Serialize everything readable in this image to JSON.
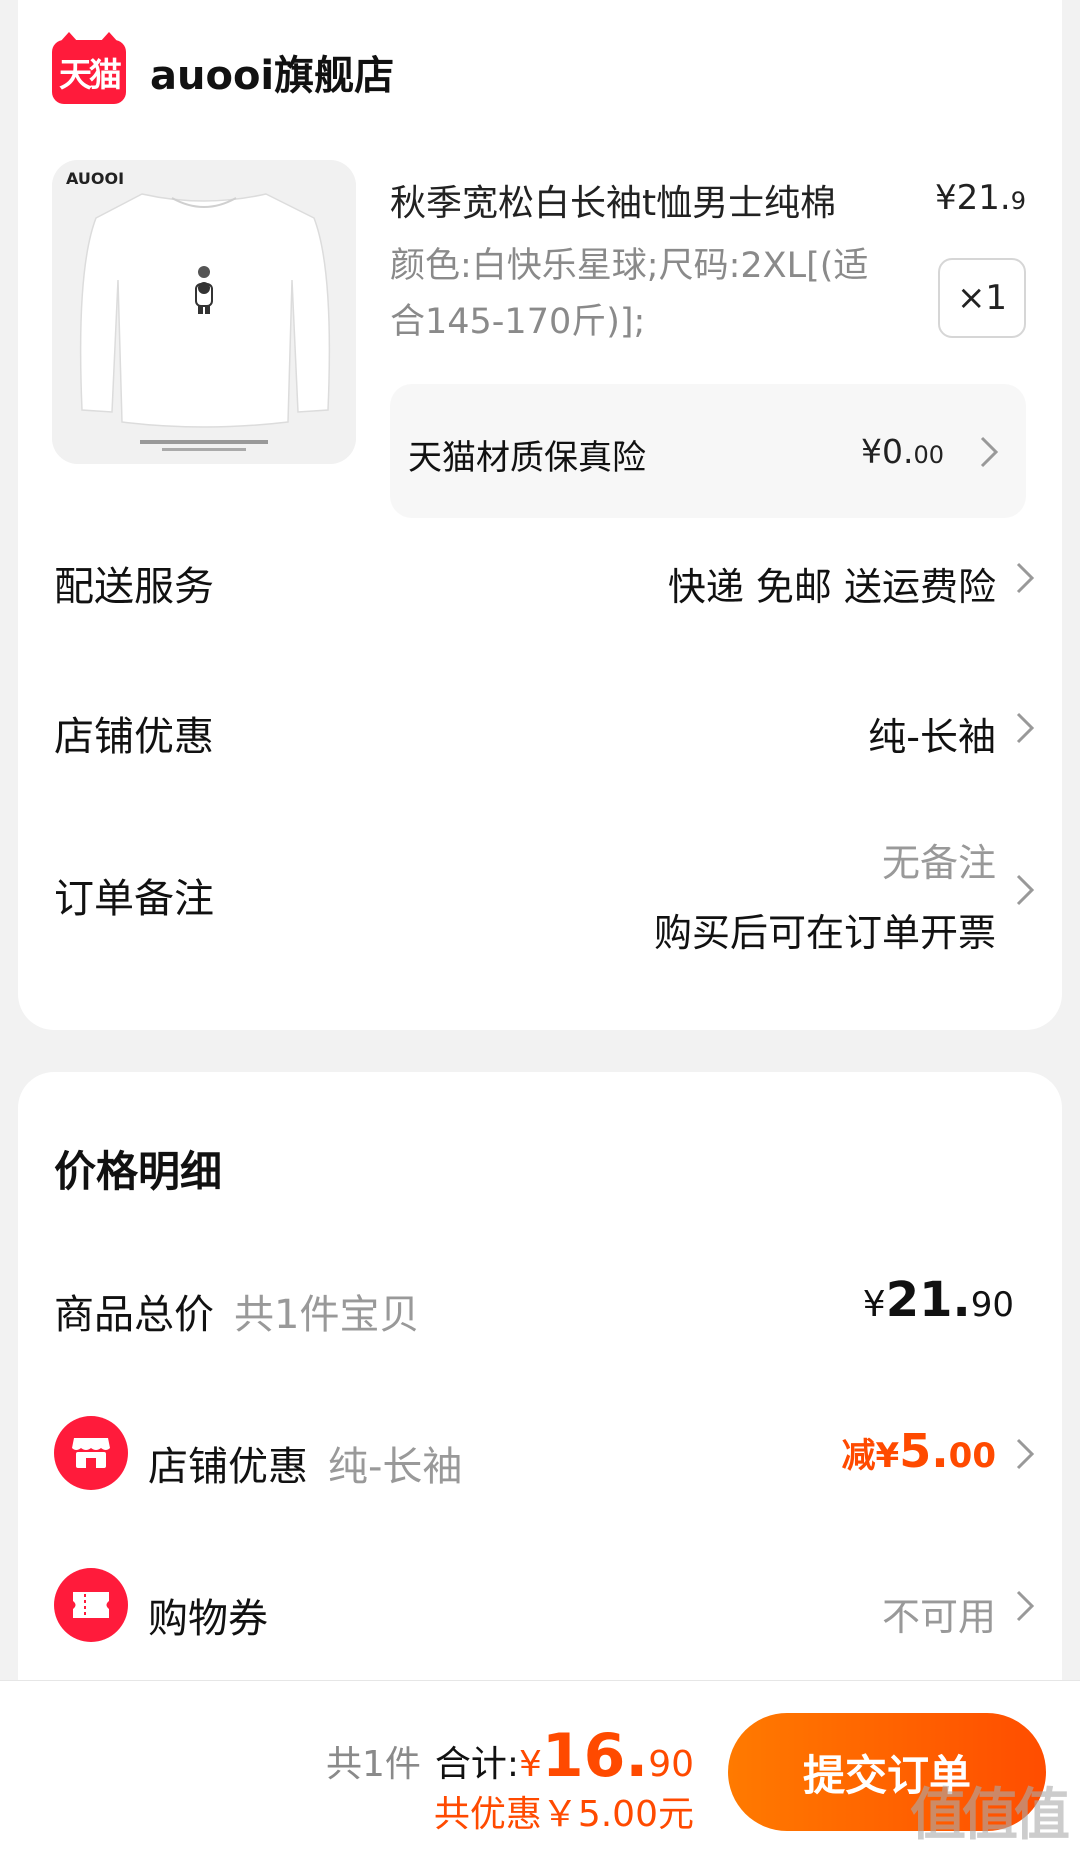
{
  "store": {
    "logo_text": "天猫",
    "name": "auooi旗舰店"
  },
  "product": {
    "brand_mark": "AUOOI",
    "title": "秋季宽松白长袖t恤男士纯棉",
    "price_currency": "¥",
    "price_int": "21.",
    "price_dec": "9",
    "spec_line1": "颜色:白快乐星球;尺码:2XL[(适",
    "spec_line2": "合145-170斤)];",
    "quantity": "×1",
    "insurance_label": "天猫材质保真险",
    "insurance_currency": "¥",
    "insurance_int": "0.",
    "insurance_dec": "00"
  },
  "rows": {
    "delivery_label": "配送服务",
    "delivery_value": "快递 免邮 送运费险",
    "coupon_label": "店铺优惠",
    "coupon_value": "纯-长袖",
    "note_label": "订单备注",
    "note_value": "无备注",
    "note_invoice": "购买后可在订单开票"
  },
  "price_detail": {
    "title": "价格明细",
    "goods_label": "商品总价",
    "goods_count": "共1件宝贝",
    "goods_currency": "¥",
    "goods_int": "21.",
    "goods_dec": "90",
    "shop_discount_label": "店铺优惠",
    "shop_discount_sub": "纯-长袖",
    "shop_discount_prefix": "减",
    "shop_discount_currency": "¥",
    "shop_discount_int": "5.",
    "shop_discount_dec": "00",
    "voucher_label": "购物券",
    "voucher_value": "不可用"
  },
  "bottom": {
    "count": "共1件",
    "total_label": "合计:",
    "total_currency": "¥",
    "total_int": "16.",
    "total_dec": "90",
    "saved": "共优惠￥5.00元",
    "submit_label": "提交订单"
  },
  "watermark": "值值值",
  "colors": {
    "accent": "#ff4a00",
    "tmall_red": "#ff1b3b"
  },
  "icons": [
    "tmall-logo-icon",
    "chevron-right-icon",
    "shop-icon",
    "ticket-icon"
  ]
}
